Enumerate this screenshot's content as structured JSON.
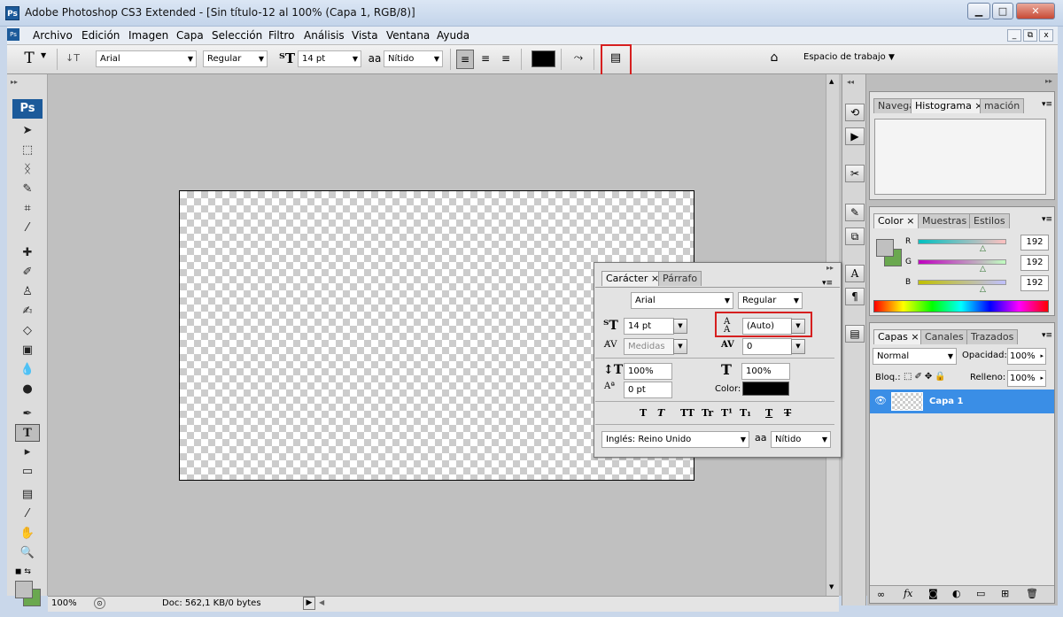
{
  "window": {
    "title": "Adobe Photoshop CS3 Extended - [Sin título-12 al 100% (Capa 1, RGB/8)]",
    "app_icon": "Ps"
  },
  "window_controls": {
    "minimize": "▁",
    "maximize": "□",
    "close": "✕"
  },
  "menu": {
    "items": [
      "Archivo",
      "Edición",
      "Imagen",
      "Capa",
      "Selección",
      "Filtro",
      "Análisis",
      "Vista",
      "Ventana",
      "Ayuda"
    ],
    "doc_controls": {
      "minimize": "_",
      "restore": "⧉",
      "close": "x"
    }
  },
  "options": {
    "tool_icon": "T",
    "font_family": "Arial",
    "font_style": "Regular",
    "font_size": "14 pt",
    "antialias_icon": "aa",
    "antialias": "Nítido",
    "text_color": "#000000",
    "workspace_label": "Espacio de trabajo"
  },
  "toolbox": {
    "logo": "Ps"
  },
  "status": {
    "zoom": "100%",
    "doc": "Doc: 562,1 KB/0 bytes"
  },
  "navigator_panel": {
    "tabs": [
      "Navega",
      "Histograma",
      "mación"
    ]
  },
  "color_panel": {
    "tabs": [
      "Color",
      "Muestras",
      "Estilos"
    ],
    "channels": [
      {
        "label": "R",
        "value": "192",
        "level": 0.75
      },
      {
        "label": "G",
        "value": "192",
        "level": 0.75
      },
      {
        "label": "B",
        "value": "192",
        "level": 0.75
      }
    ],
    "foreground": "#c0c0c0",
    "background": "#6aa84f"
  },
  "layers_panel": {
    "tabs": [
      "Capas",
      "Canales",
      "Trazados"
    ],
    "blend_mode": "Normal",
    "opacity_label": "Opacidad:",
    "opacity": "100%",
    "lock_label": "Bloq.:",
    "fill_label": "Relleno:",
    "fill": "100%",
    "layers": [
      {
        "name": "Capa 1",
        "selected": true
      }
    ]
  },
  "character_panel": {
    "tabs": [
      "Carácter",
      "Párrafo"
    ],
    "font_family": "Arial",
    "font_style": "Regular",
    "font_size": "14 pt",
    "leading": "(Auto)",
    "kerning": "Medidas",
    "tracking": "0",
    "vertical_scale": "100%",
    "horizontal_scale": "100%",
    "baseline_shift": "0 pt",
    "color_label": "Color:",
    "color": "#000000",
    "style_buttons": [
      "T",
      "T",
      "TT",
      "Tr",
      "T¹",
      "T₁",
      "T",
      "T"
    ],
    "language": "Inglés: Reino Unido",
    "antialias_icon": "aa",
    "antialias": "Nítido"
  }
}
